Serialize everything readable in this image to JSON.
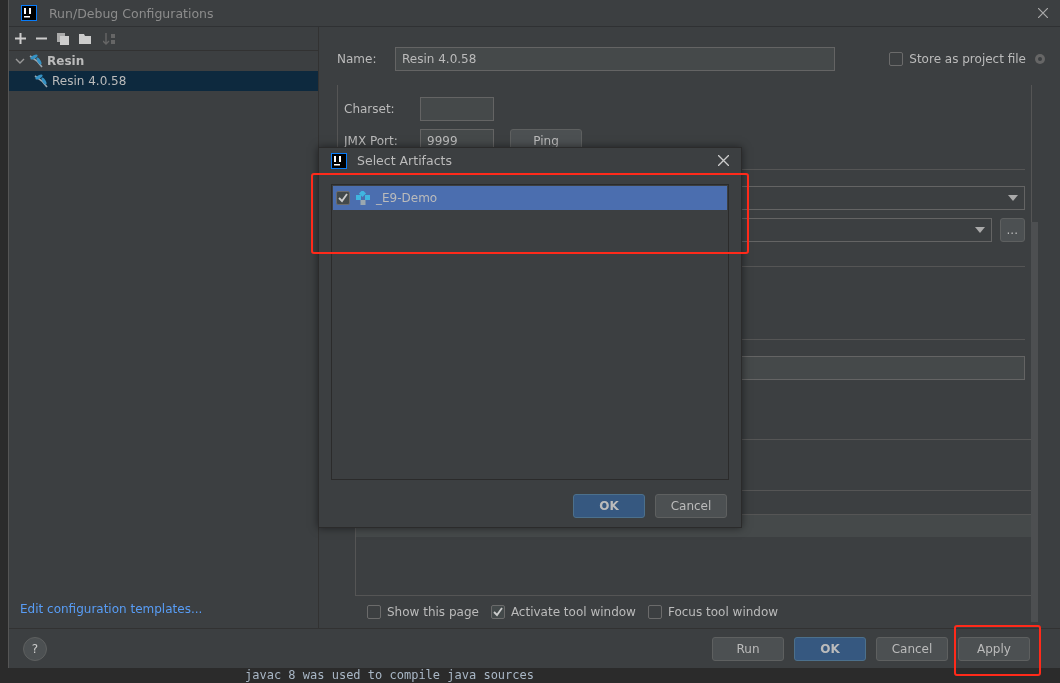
{
  "window": {
    "title": "Run/Debug Configurations"
  },
  "tree": [
    {
      "label": "Resin",
      "expanded": true,
      "selected": false,
      "children": [
        {
          "label": "Resin 4.0.58",
          "selected": true
        }
      ]
    }
  ],
  "name_field": {
    "label": "Name:",
    "value": "Resin 4.0.58"
  },
  "store_as_project_file": {
    "label": "Store as project file",
    "checked": false
  },
  "charset": {
    "label": "Charset:"
  },
  "jmx_port": {
    "label": "JMX Port:",
    "value": "9999",
    "button": "Ping"
  },
  "browse_button": "...",
  "launch_options": [
    {
      "label": "Show this page",
      "checked": false
    },
    {
      "label": "Activate tool window",
      "checked": true
    },
    {
      "label": "Focus tool window",
      "checked": false
    }
  ],
  "templates_link": "Edit configuration templates...",
  "help": "?",
  "buttons": [
    {
      "label": "Run",
      "primary": false
    },
    {
      "label": "OK",
      "primary": true
    },
    {
      "label": "Cancel",
      "primary": false
    },
    {
      "label": "Apply",
      "primary": false
    }
  ],
  "artifacts_dialog": {
    "title": "Select Artifacts",
    "items": [
      {
        "label": "_E9-Demo",
        "checked": true,
        "selected": true
      }
    ],
    "buttons": [
      {
        "label": "OK",
        "primary": true
      },
      {
        "label": "Cancel",
        "primary": false
      }
    ]
  },
  "console_line": "javac 8 was used to compile java sources"
}
